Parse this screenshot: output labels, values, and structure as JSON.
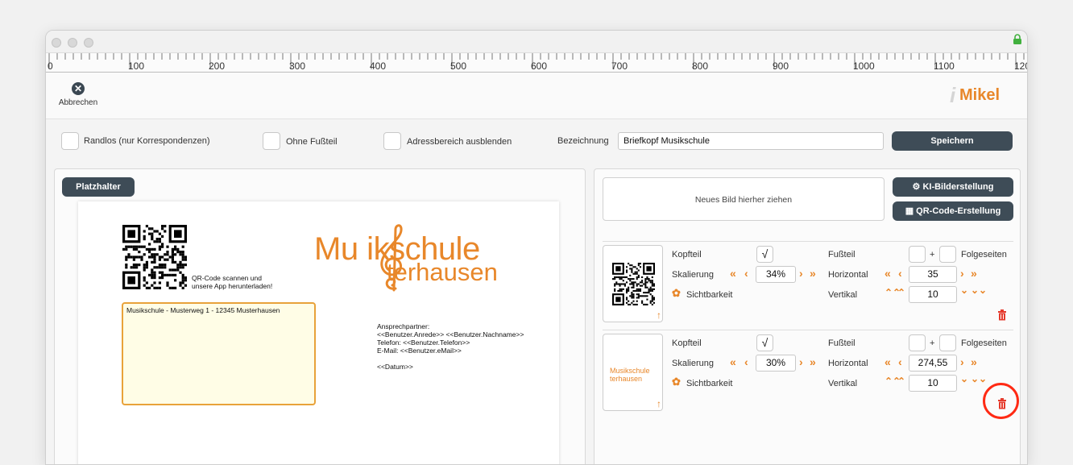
{
  "window": {
    "ruler_labels": [
      "0",
      "100",
      "200",
      "300",
      "400",
      "500",
      "600",
      "700",
      "800",
      "900",
      "1000",
      "1100",
      "120"
    ]
  },
  "toolbar": {
    "cancel_label": "Abbrechen",
    "logo_prefix": "i",
    "logo_text": "Mikel",
    "accent_color": "#e8872a"
  },
  "options": {
    "borderless_label": "Randlos (nur Korrespondenzen)",
    "no_footer_label": "Ohne Fußteil",
    "hide_address_label": "Adressbereich ausblenden",
    "name_label": "Bezeichnung",
    "name_value": "Briefkopf Musikschule",
    "save_label": "Speichern"
  },
  "left": {
    "placeholder_label": "Platzhalter",
    "qr_caption_line1": "QR-Code scannen und",
    "qr_caption_line2": "unsere App herunterladen!",
    "brand_line1": "Mu    ikschule",
    "brand_line2": "terhausen",
    "address": "Musikschule - Musterweg 1 - 12345 Musterhausen",
    "contact_lines": [
      "Ansprechpartner:",
      "<<Benutzer.Anrede>> <<Benutzer.Nachname>>",
      "Telefon: <<Benutzer.Telefon>>",
      "E-Mail: <<Benutzer.eMail>>",
      "",
      "<<Datum>>"
    ]
  },
  "right": {
    "dropzone_text": "Neues Bild hierher ziehen",
    "ai_button": "KI-Bilderstellung",
    "qr_button": "QR-Code-Erstellung",
    "items": [
      {
        "header_label": "Kopfteil",
        "header_checked": "√",
        "footer_label": "Fußteil",
        "plus": "+",
        "following_label": "Folgeseiten",
        "scale_label": "Skalierung",
        "scale_value": "34%",
        "horizontal_label": "Horizontal",
        "horizontal_value": "35",
        "visibility_label": "Sichtbarkeit",
        "vertical_label": "Vertikal",
        "vertical_value": "10",
        "thumbnail_text": ""
      },
      {
        "header_label": "Kopfteil",
        "header_checked": "√",
        "footer_label": "Fußteil",
        "plus": "+",
        "following_label": "Folgeseiten",
        "scale_label": "Skalierung",
        "scale_value": "30%",
        "horizontal_label": "Horizontal",
        "horizontal_value": "274,55",
        "visibility_label": "Sichtbarkeit",
        "vertical_label": "Vertikal",
        "vertical_value": "10",
        "thumbnail_text": "Musikschule terhausen"
      }
    ]
  }
}
